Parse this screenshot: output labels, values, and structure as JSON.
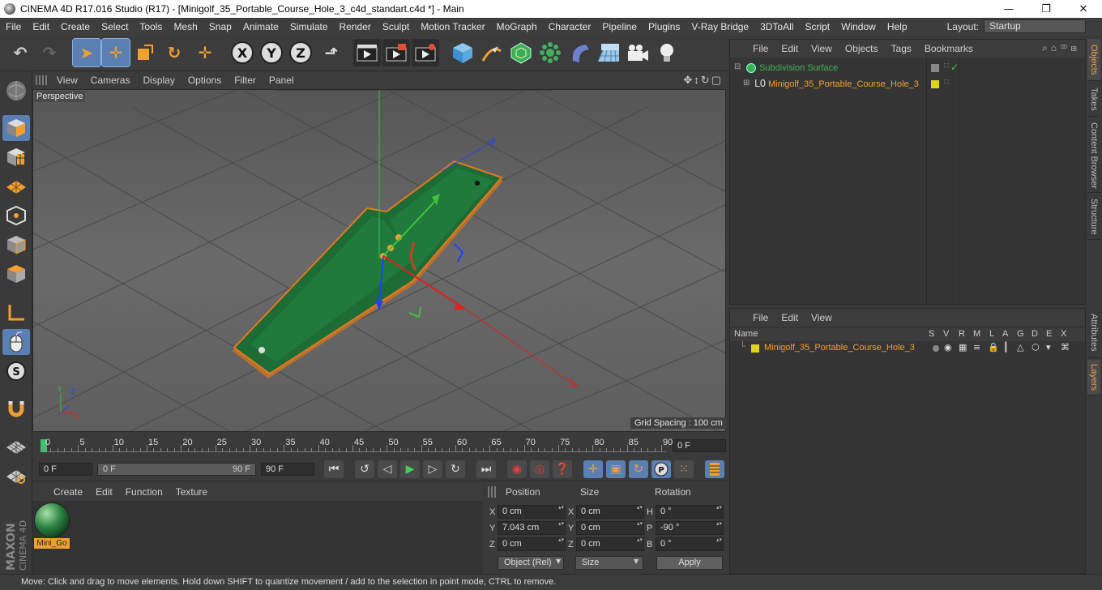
{
  "window": {
    "title": "CINEMA 4D R17.016 Studio (R17) - [Minigolf_35_Portable_Course_Hole_3_c4d_standart.c4d *] - Main",
    "minimize": "—",
    "maximize": "❐",
    "close": "✕"
  },
  "menubar": {
    "items": [
      "File",
      "Edit",
      "Create",
      "Select",
      "Tools",
      "Mesh",
      "Snap",
      "Animate",
      "Simulate",
      "Render",
      "Sculpt",
      "Motion Tracker",
      "MoGraph",
      "Character",
      "Pipeline",
      "Plugins",
      "V-Ray Bridge",
      "3DToAll",
      "Script",
      "Window",
      "Help"
    ],
    "layout_label": "Layout:",
    "layout_value": "Startup"
  },
  "toolbar": {
    "axis_x": "X",
    "axis_y": "Y",
    "axis_z": "Z"
  },
  "viewport": {
    "menu": [
      "View",
      "Cameras",
      "Display",
      "Options",
      "Filter",
      "Panel"
    ],
    "camera_label": "Perspective",
    "grid_spacing": "Grid Spacing : 100 cm"
  },
  "timeline": {
    "ticks": [
      "0",
      "5",
      "10",
      "15",
      "20",
      "25",
      "30",
      "35",
      "40",
      "45",
      "50",
      "55",
      "60",
      "65",
      "70",
      "75",
      "80",
      "85",
      "90"
    ],
    "current_frame": "0 F",
    "start_field": "0 F",
    "range_start": "0 F",
    "range_end": "90 F",
    "end_field": "90 F"
  },
  "material_manager": {
    "menu": [
      "Create",
      "Edit",
      "Function",
      "Texture"
    ],
    "material_name": "Mini_Go"
  },
  "coordinates": {
    "headers": {
      "position": "Position",
      "size": "Size",
      "rotation": "Rotation"
    },
    "rows": [
      {
        "axis": "X",
        "pos": "0 cm",
        "size_axis": "X",
        "size": "0 cm",
        "rot_axis": "H",
        "rot": "0 °"
      },
      {
        "axis": "Y",
        "pos": "7.043 cm",
        "size_axis": "Y",
        "size": "0 cm",
        "rot_axis": "P",
        "rot": "-90 °"
      },
      {
        "axis": "Z",
        "pos": "0 cm",
        "size_axis": "Z",
        "size": "0 cm",
        "rot_axis": "B",
        "rot": "0 °"
      }
    ],
    "mode_dropdown": "Object (Rel)",
    "size_dropdown": "Size",
    "apply_button": "Apply"
  },
  "object_manager": {
    "menu": [
      "File",
      "Edit",
      "View",
      "Objects",
      "Tags",
      "Bookmarks"
    ],
    "objects": [
      {
        "name": "Subdivision Surface"
      },
      {
        "name": "Minigolf_35_Portable_Course_Hole_3"
      }
    ]
  },
  "layer_manager": {
    "menu": [
      "File",
      "Edit",
      "View"
    ],
    "columns": {
      "name": "Name",
      "flags": [
        "S",
        "V",
        "R",
        "M",
        "L",
        "A",
        "G",
        "D",
        "E",
        "X"
      ]
    },
    "layers": [
      {
        "name": "Minigolf_35_Portable_Course_Hole_3"
      }
    ]
  },
  "side_tabs": [
    "Objects",
    "Takes",
    "Content Browser",
    "Structure",
    "Attributes",
    "Layers"
  ],
  "status_bar": "Move: Click and drag to move elements. Hold down SHIFT to quantize movement / add to the selection in point mode, CTRL to remove.",
  "brand": {
    "maxon": "MAXON",
    "cinema": "CINEMA 4D"
  },
  "colors": {
    "accent": "#5a7fb3",
    "object_text": "#f0a030",
    "grass": "#1d6b35"
  }
}
